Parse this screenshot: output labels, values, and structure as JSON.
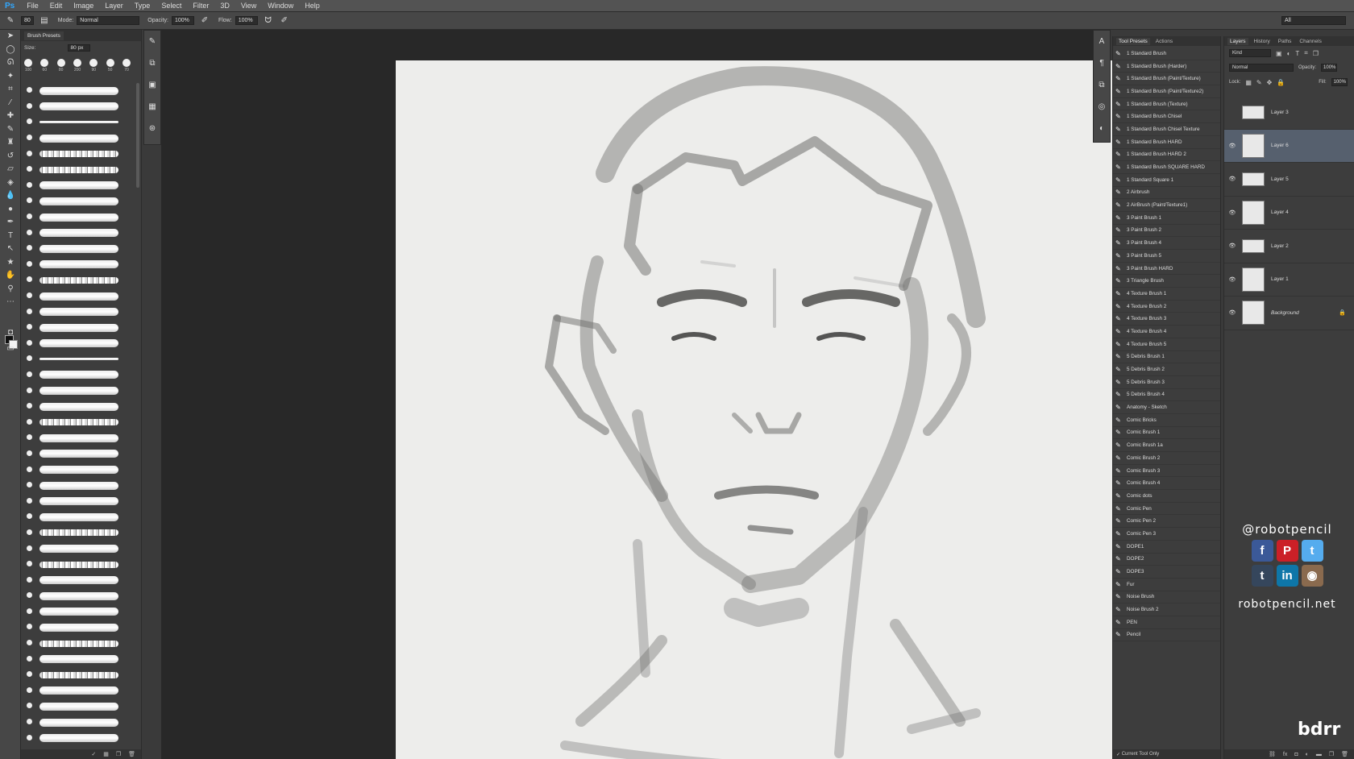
{
  "app": {
    "logo": "Ps"
  },
  "menu": [
    "File",
    "Edit",
    "Image",
    "Layer",
    "Type",
    "Select",
    "Filter",
    "3D",
    "View",
    "Window",
    "Help"
  ],
  "options": {
    "brush_size": "80",
    "mode_label": "Mode:",
    "mode_value": "Normal",
    "opacity_label": "Opacity:",
    "opacity_value": "100%",
    "flow_label": "Flow:",
    "flow_value": "100%",
    "workspace": "All"
  },
  "brush_presets": {
    "tab": "Brush Presets",
    "size_label": "Size:",
    "size_value": "80 px",
    "tips": [
      "100",
      "60",
      "80",
      "200",
      "90",
      "50",
      "70"
    ],
    "footer_icons": [
      "check-icon",
      "grid-icon",
      "new-icon",
      "trash-icon"
    ]
  },
  "tool_presets": {
    "tabs": [
      "Tool Presets",
      "Actions"
    ],
    "items": [
      "1 Standard Brush",
      "1 Standard Brush (Harder)",
      "1 Standard Brush (Paint/Texture)",
      "1 Standard Brush (Paint/Texture2)",
      "1 Standard Brush (Texture)",
      "1 Standard Brush Chisel",
      "1 Standard Brush Chisel Texture",
      "1 Standard Brush HARD",
      "1 Standard Brush HARD 2",
      "1 Standard Brush SQUARE HARD",
      "1 Standard Square 1",
      "2 Airbrush",
      "2 AirBrush (Paint/Texture1)",
      "3 Paint Brush 1",
      "3 Paint Brush 2",
      "3 Paint Brush 4",
      "3 Paint Brush 5",
      "3 Paint Brush HARD",
      "3 Triangle Brush",
      "4 Texture Brush 1",
      "4 Texture Brush 2",
      "4 Texture Brush 3",
      "4 Texture Brush 4",
      "4 Texture Brush 5",
      "5 Debris Brush 1",
      "5 Debris Brush 2",
      "5 Debris Brush 3",
      "5 Debris Brush 4",
      "Anatomy - Sketch",
      "Comic Bricks",
      "Comic Brush 1",
      "Comic Brush 1a",
      "Comic Brush 2",
      "Comic Brush 3",
      "Comic Brush 4",
      "Comic dots",
      "Comic Pen",
      "Comic Pen 2",
      "Comic Pen 3",
      "DOPE1",
      "DOPE2",
      "DOPE3",
      "Fur",
      "Noise Brush",
      "Noise Brush 2",
      "PEN",
      "Pencil"
    ],
    "footer": "Current Tool Only"
  },
  "layers": {
    "tabs": [
      "Layers",
      "History",
      "Paths",
      "Channels"
    ],
    "kind": "Kind",
    "blend": "Normal",
    "opacity_label": "Opacity:",
    "opacity_value": "100%",
    "lock_label": "Lock:",
    "fill_label": "Fill:",
    "fill_value": "100%",
    "items": [
      {
        "name": "Layer 3",
        "visible": false,
        "active": false
      },
      {
        "name": "Layer 6",
        "visible": true,
        "active": true
      },
      {
        "name": "Layer 5",
        "visible": true,
        "active": false
      },
      {
        "name": "Layer 4",
        "visible": true,
        "active": false
      },
      {
        "name": "Layer 2",
        "visible": true,
        "active": false
      },
      {
        "name": "Layer 1",
        "visible": true,
        "active": false
      },
      {
        "name": "Background",
        "visible": true,
        "active": false
      }
    ]
  },
  "branding": {
    "handle": "@robotpencil",
    "url": "robotpencil.net",
    "watermark": "bdrr",
    "social": [
      {
        "name": "facebook-icon",
        "glyph": "f",
        "color": "#3b5998"
      },
      {
        "name": "pinterest-icon",
        "glyph": "P",
        "color": "#cb2027"
      },
      {
        "name": "twitter-icon",
        "glyph": "t",
        "color": "#55acee"
      },
      {
        "name": "tumblr-icon",
        "glyph": "t",
        "color": "#35465c"
      },
      {
        "name": "linkedin-icon",
        "glyph": "in",
        "color": "#0e76a8"
      },
      {
        "name": "instagram-icon",
        "glyph": "◉",
        "color": "#8a6a4e"
      }
    ]
  }
}
